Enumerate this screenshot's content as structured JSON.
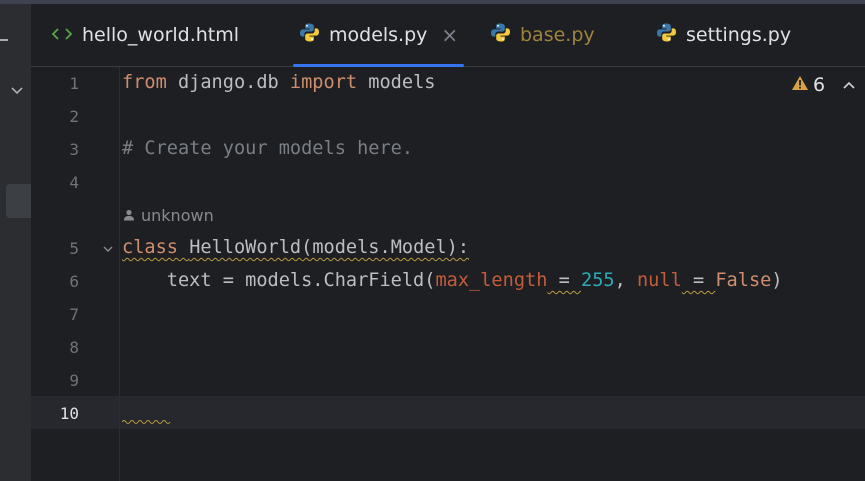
{
  "tabs": [
    {
      "label": "hello_world.html",
      "icon": "html-tag-icon"
    },
    {
      "label": "models.py",
      "icon": "python-icon",
      "active": true,
      "close": "×"
    },
    {
      "label": "base.py",
      "icon": "python-icon"
    },
    {
      "label": "settings.py",
      "icon": "python-icon"
    }
  ],
  "editor": {
    "line_numbers": [
      "1",
      "2",
      "3",
      "4",
      "5",
      "6",
      "7",
      "8",
      "9",
      "10"
    ],
    "current_line": "10",
    "author": "unknown",
    "warnings_count": "6",
    "code": {
      "l1": {
        "kw1": "from",
        "t1": " django.db ",
        "kw2": "import",
        "t2": " models"
      },
      "l3": {
        "comment": "# Create your models here."
      },
      "l5": {
        "kw": "class",
        "t1": " ",
        "name": "HelloWorld",
        "t2": "(models.Model):"
      },
      "l6": {
        "t1": "    text = models.CharField(",
        "p1": "max_length",
        "eq1": " = ",
        "n1": "255",
        "c1": ", ",
        "p2": "null",
        "eq2": " = ",
        "kw": "False",
        "t2": ")"
      }
    }
  },
  "colors": {
    "keyword": "#cf8e6d",
    "comment": "#7a7e85",
    "number": "#2aacb8",
    "param": "#c45c3b",
    "accent": "#3574f0",
    "warning": "#d9a343"
  }
}
